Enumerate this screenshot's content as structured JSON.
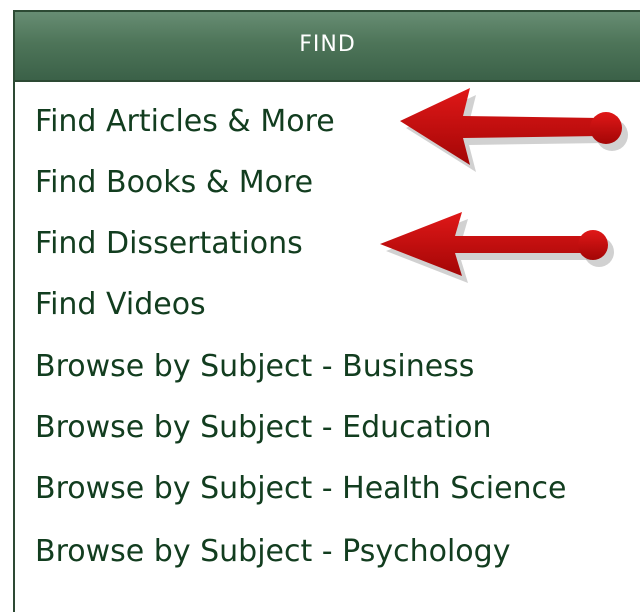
{
  "panel": {
    "title": "FIND",
    "items": [
      {
        "label": "Find Articles & More"
      },
      {
        "label": "Find Books & More"
      },
      {
        "label": "Find Dissertations"
      },
      {
        "label": "Find Videos"
      },
      {
        "label": "Browse by Subject - Business"
      },
      {
        "label": "Browse by Subject - Education"
      },
      {
        "label": "Browse by Subject - Health Science"
      },
      {
        "label": "Browse by Subject - Psychology"
      }
    ]
  },
  "colors": {
    "header_green": "#4e7559",
    "link_green": "#123d1f",
    "arrow_red": "#c00b0b"
  },
  "annotations": {
    "arrow_icon": "red-pointer-arrow-icon"
  }
}
